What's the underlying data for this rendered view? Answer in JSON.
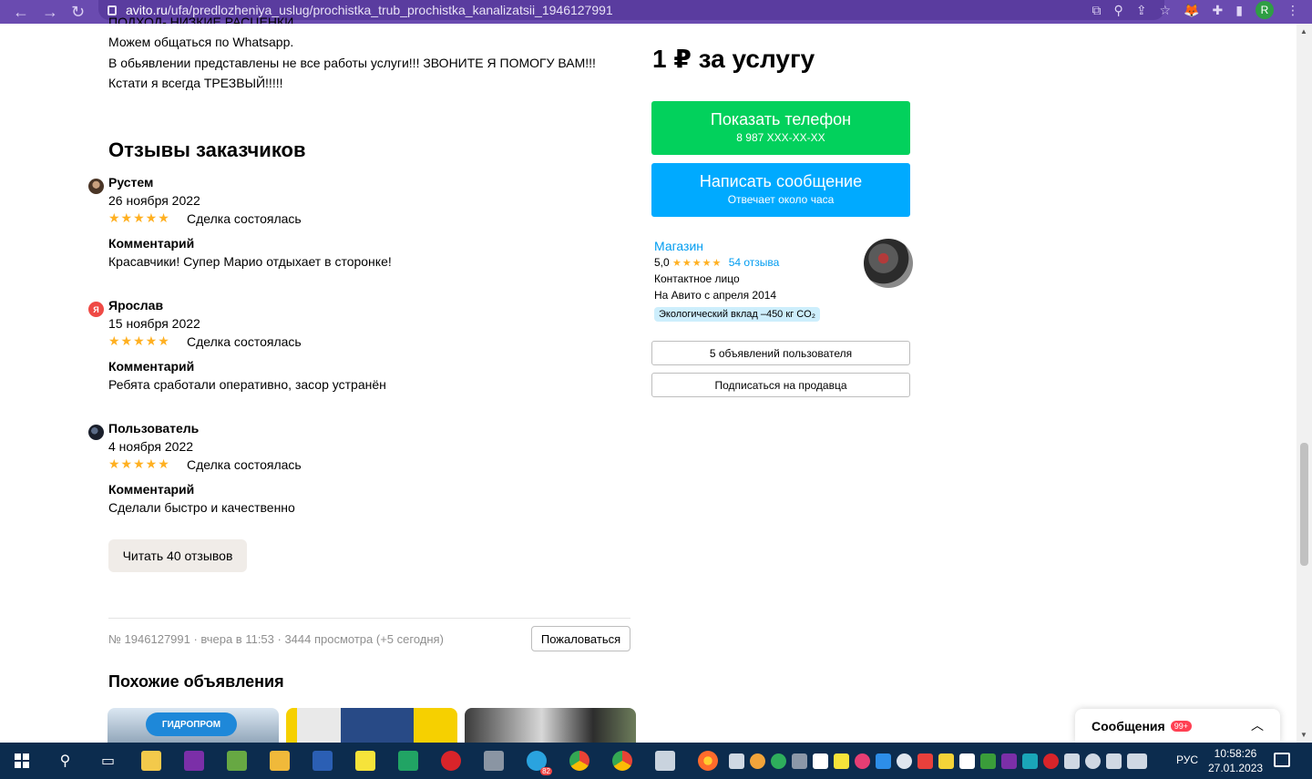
{
  "browser": {
    "url_host": "avito.ru",
    "url_path": "/ufa/predlozheniya_uslug/prochistka_trub_prochistka_kanalizatsii_1946127991",
    "profile_initial": "R"
  },
  "description": {
    "cut_line": "ПОДХОД- НИЗКИЕ РАСЦЕНКИ",
    "lines": [
      "Можем общаться по Whatsapp.",
      "В обьявлении представлены не все работы услуги!!! ЗВОНИТЕ Я ПОМОГУ ВАМ!!!",
      "Кстати я всегда ТРЕЗВЫЙ!!!!!"
    ]
  },
  "reviews": {
    "title": "Отзывы заказчиков",
    "items": [
      {
        "name": "Рустем",
        "date": "26 ноября 2022",
        "stars": "★★★★★",
        "deal": "Сделка состоялась",
        "comment_head": "Комментарий",
        "comment": "Красавчики! Супер Марио отдыхает в сторонке!",
        "avatar_letter": ""
      },
      {
        "name": "Ярослав",
        "date": "15 ноября 2022",
        "stars": "★★★★★",
        "deal": "Сделка состоялась",
        "comment_head": "Комментарий",
        "comment": "Ребята сработали оперативно, засор устранён",
        "avatar_letter": "Я"
      },
      {
        "name": "Пользователь",
        "date": "4 ноября 2022",
        "stars": "★★★★★",
        "deal": "Сделка состоялась",
        "comment_head": "Комментарий",
        "comment": "Сделали быстро и качественно",
        "avatar_letter": ""
      }
    ],
    "read_more": "Читать 40 отзывов"
  },
  "meta": {
    "info": "№ 1946127991 · вчера в 11:53 · 3444 просмотра (+5 сегодня)",
    "complain": "Пожаловаться"
  },
  "similar": {
    "title": "Похожие объявления",
    "thumb1_logo": "ГИДРОПРОМ"
  },
  "sidebar": {
    "price": "1 ₽ за услугу",
    "phone_btn": "Показать телефон",
    "phone_sub": "8 987 XXX-XX-XX",
    "msg_btn": "Написать сообщение",
    "msg_sub": "Отвечает около часа",
    "seller": {
      "type": "Магазин",
      "rating": "5,0",
      "stars": "★★★★★",
      "reviews": "54 отзыва",
      "contact": "Контактное лицо",
      "since": "На Авито с апреля 2014",
      "eco": "Экологический вклад –450 кг CO₂"
    },
    "ads_btn": "5 объявлений пользователя",
    "subscribe_btn": "Подписаться на продавца"
  },
  "messages": {
    "label": "Сообщения",
    "badge": "99+"
  },
  "taskbar": {
    "lang": "РУС",
    "time": "10:58:26",
    "date": "27.01.2023",
    "telegram_badge": "82"
  },
  "colors": {
    "browser_bar": "#6a4bb0",
    "phone_btn": "#02d15c",
    "msg_btn": "#00aaff",
    "link": "#009cf0",
    "star": "#ffb021",
    "taskbar": "#0c2c4e"
  }
}
